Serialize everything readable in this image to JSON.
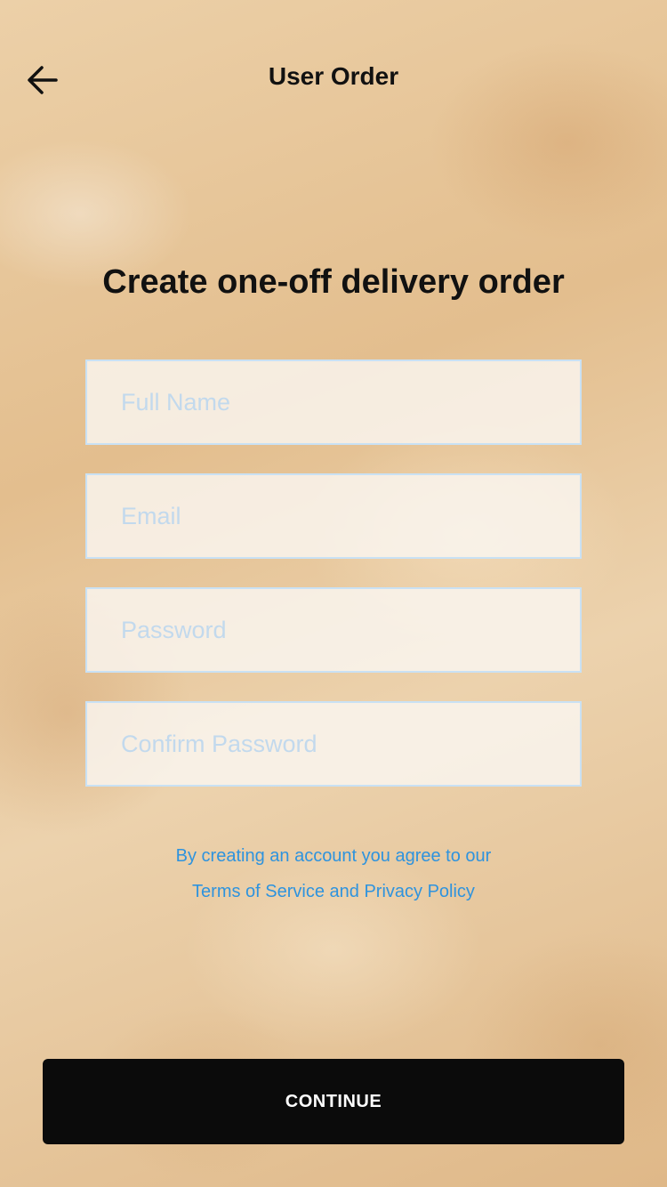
{
  "header": {
    "title": "User Order",
    "back_icon": "arrow-left-icon"
  },
  "main": {
    "heading": "Create one-off delivery order",
    "fields": {
      "full_name": {
        "placeholder": "Full Name",
        "value": ""
      },
      "email": {
        "placeholder": "Email",
        "value": ""
      },
      "password": {
        "placeholder": "Password",
        "value": ""
      },
      "confirm_password": {
        "placeholder": "Confirm Password",
        "value": ""
      }
    },
    "terms": {
      "line1": "By creating an account you agree to our",
      "link": "Terms of Service and Privacy Policy"
    },
    "continue_label": "CONTINUE"
  },
  "colors": {
    "link": "#2e93de",
    "field_border": "#c9e1f4",
    "button_bg": "#0b0b0b"
  }
}
